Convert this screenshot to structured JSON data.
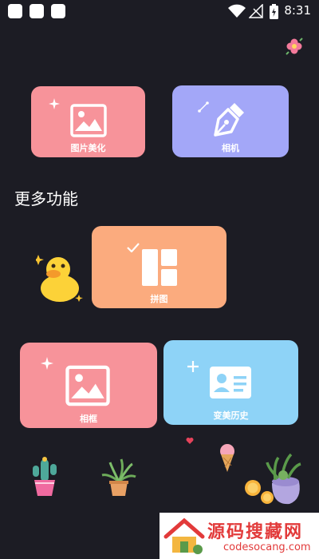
{
  "status_bar": {
    "time": "8:31"
  },
  "cards": {
    "photo_beautify": {
      "label": "图片美化",
      "color": "#f7939a"
    },
    "camera": {
      "label": "相机",
      "color": "#a3a7f8"
    },
    "collage": {
      "label": "拼图",
      "color": "#fbab7e"
    },
    "frame": {
      "label": "相框",
      "color": "#f7939a"
    },
    "id_photo": {
      "label": "变美历史",
      "color": "#8ed3f7"
    }
  },
  "section": {
    "more_features": "更多功能"
  },
  "watermark": {
    "title": "源码搜藏网",
    "subtitle": "codesocang.com"
  },
  "icons": {
    "status_squares": "app-notification-icon",
    "wifi": "wifi-icon",
    "signal": "signal-icon",
    "battery": "battery-icon",
    "flower_top": "flower-icon",
    "duck": "duck-icon",
    "cactus": "cactus-icon",
    "plant": "plant-icon",
    "ice_cream": "ice-cream-icon",
    "succulent": "succulent-icon",
    "heart": "heart-icon"
  }
}
